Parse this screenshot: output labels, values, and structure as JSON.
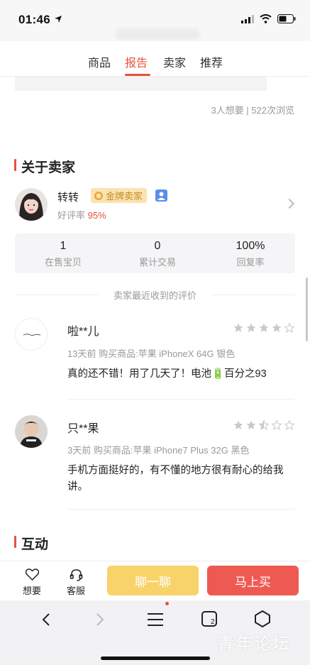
{
  "status_bar": {
    "time": "01:46"
  },
  "tabs": [
    {
      "label": "商品"
    },
    {
      "label": "报告"
    },
    {
      "label": "卖家"
    },
    {
      "label": "推荐"
    }
  ],
  "views_text": "3人想要 | 522次浏览",
  "seller_section": {
    "title": "关于卖家",
    "name": "转转",
    "badge": "金牌卖家",
    "rating_label": "好评率",
    "rating_value": "95%",
    "stats": [
      {
        "num": "1",
        "label": "在售宝贝"
      },
      {
        "num": "0",
        "label": "累计交易"
      },
      {
        "num": "100%",
        "label": "回复率"
      }
    ],
    "reviews_header": "卖家最近收到的评价"
  },
  "reviews": [
    {
      "name": "啦**儿",
      "stars": 4,
      "meta": "13天前 购买商品:苹果 iPhoneX 64G 银色",
      "text": "真的还不错！用了几天了！电池🔋百分之93"
    },
    {
      "name": "只**果",
      "stars": 2.5,
      "meta": "3天前 购买商品:苹果 iPhone7 Plus 32G 黑色",
      "text": "手机方面挺好的，有不懂的地方很有耐心的给我讲。"
    }
  ],
  "interaction_section": {
    "title": "互动"
  },
  "bottom_bar": {
    "want": "想要",
    "service": "客服",
    "chat_button": "聊一聊",
    "buy_button": "马上买"
  },
  "watermark": "青年论坛",
  "colors": {
    "accent": "#e8513a",
    "chat": "#f8d36a",
    "buy": "#ee5a52"
  }
}
